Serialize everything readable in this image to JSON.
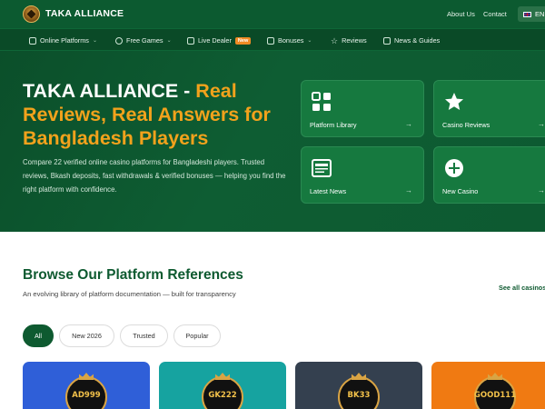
{
  "header": {
    "brand": "TAKA ALLIANCE",
    "links": [
      "About Us",
      "Contact"
    ],
    "lang": "EN"
  },
  "nav": [
    {
      "label": "Online Platforms",
      "icon": "grid-icon",
      "dropdown": true
    },
    {
      "label": "Free Games",
      "icon": "gamepad-icon",
      "dropdown": true
    },
    {
      "label": "Live Dealer",
      "icon": "cards-icon",
      "badge": "New"
    },
    {
      "label": "Bonuses",
      "icon": "gift-icon",
      "dropdown": true
    },
    {
      "label": "Reviews",
      "icon": "star-icon"
    },
    {
      "label": "News & Guides",
      "icon": "document-icon"
    }
  ],
  "hero": {
    "title_prefix": "TAKA ALLIANCE - ",
    "title_accent": "Real Reviews, Real Answers for Bangladesh Players",
    "description": "Compare 22 verified online casino platforms for Bangladeshi players. Trusted reviews, Bkash deposits, fast withdrawals & verified bonuses — helping you find the right platform with confidence.",
    "tiles": [
      {
        "label": "Platform Library",
        "icon": "apps-icon"
      },
      {
        "label": "Casino Reviews",
        "icon": "star-icon"
      },
      {
        "label": "Latest News",
        "icon": "newspaper-icon"
      },
      {
        "label": "New Casino",
        "icon": "plus-circle-icon"
      }
    ],
    "arrow": "→"
  },
  "section": {
    "title": "Browse Our Platform References",
    "subtitle": "An evolving library of platform documentation — built for transparency",
    "see_all": "See all casinos"
  },
  "filters": [
    "All",
    "New 2026",
    "Trusted",
    "Popular"
  ],
  "cards": [
    {
      "logo_text": "AD999",
      "color": "#2f5fd8"
    },
    {
      "logo_text": "GK222",
      "color": "#16a3a0"
    },
    {
      "logo_text": "BK33",
      "color": "#34404f"
    },
    {
      "logo_text": "GOOD111",
      "color": "#f07a12"
    }
  ]
}
